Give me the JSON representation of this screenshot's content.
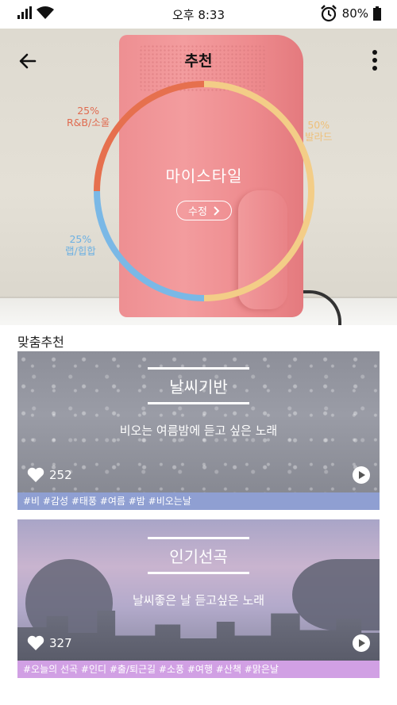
{
  "status_bar": {
    "time": "오후 8:33",
    "battery": "80%"
  },
  "header": {
    "title": "추천"
  },
  "donut": {
    "center_title": "마이스타일",
    "edit_label": "수정",
    "segments": [
      {
        "percent": "50%",
        "label": "발라드",
        "value": 50,
        "color": "#f3cd87"
      },
      {
        "percent": "25%",
        "label": "랩/힙합",
        "value": 25,
        "color": "#7ab8e6"
      },
      {
        "percent": "25%",
        "label": "R&B/소울",
        "value": 25,
        "color": "#e6704e"
      }
    ]
  },
  "section": {
    "title": "맞춤추천"
  },
  "cards": [
    {
      "title": "날씨기반",
      "subtitle": "비오는 여름밤에 듣고 싶은 노래",
      "likes": "252",
      "tags": "#비 #감성 #태풍 #여름 #밤 #비오는날"
    },
    {
      "title": "인기선곡",
      "subtitle": "날씨좋은 날 듣고싶은 노래",
      "likes": "327",
      "tags": "#오늘의 선곡 #인디 #출/퇴근길 #소풍 #여행 #산책 #맑은날"
    }
  ]
}
